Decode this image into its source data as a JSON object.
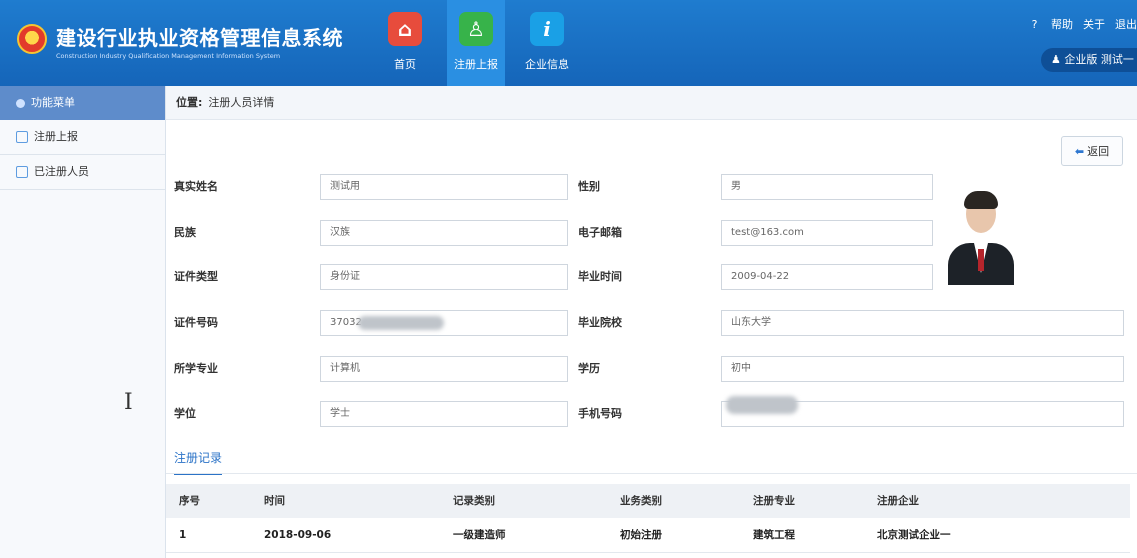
{
  "header": {
    "title": "建设行业执业资格管理信息系统",
    "subtitle": "Construction Industry Qualification Management Information System",
    "nav": [
      {
        "label": "首页",
        "icon": "home-icon",
        "color": "#e74c3c"
      },
      {
        "label": "注册上报",
        "icon": "person-search-icon",
        "color": "#37b34a"
      },
      {
        "label": "企业信息",
        "icon": "info-icon",
        "color": "#1aa0e6"
      }
    ],
    "links": {
      "help": "帮助",
      "about": "关于",
      "logout": "退出"
    },
    "user": {
      "label": "企业版 测试一"
    }
  },
  "sidebar": {
    "title": "功能菜单",
    "items": [
      {
        "label": "注册上报"
      },
      {
        "label": "已注册人员"
      }
    ]
  },
  "breadcrumb": {
    "prefix": "位置:",
    "page": "注册人员详情"
  },
  "back_label": "返回",
  "form": {
    "real_name": {
      "label": "真实姓名",
      "value": "测试用"
    },
    "gender": {
      "label": "性别",
      "value": "男"
    },
    "ethnicity": {
      "label": "民族",
      "value": "汉族"
    },
    "email": {
      "label": "电子邮箱",
      "value": "test@163.com"
    },
    "id_type": {
      "label": "证件类型",
      "value": "身份证"
    },
    "grad_date": {
      "label": "毕业时间",
      "value": "2009-04-22"
    },
    "id_number": {
      "label": "证件号码",
      "value": "37032"
    },
    "school": {
      "label": "毕业院校",
      "value": "山东大学"
    },
    "major": {
      "label": "所学专业",
      "value": "计算机"
    },
    "education": {
      "label": "学历",
      "value": "初中"
    },
    "degree": {
      "label": "学位",
      "value": "学士"
    },
    "phone": {
      "label": "手机号码",
      "value": ""
    }
  },
  "records": {
    "tab_label": "注册记录",
    "columns": [
      "序号",
      "时间",
      "记录类别",
      "业务类别",
      "注册专业",
      "注册企业"
    ],
    "rows": [
      [
        "1",
        "2018-09-06",
        "一级建造师",
        "初始注册",
        "建筑工程",
        "北京测试企业一"
      ]
    ]
  }
}
